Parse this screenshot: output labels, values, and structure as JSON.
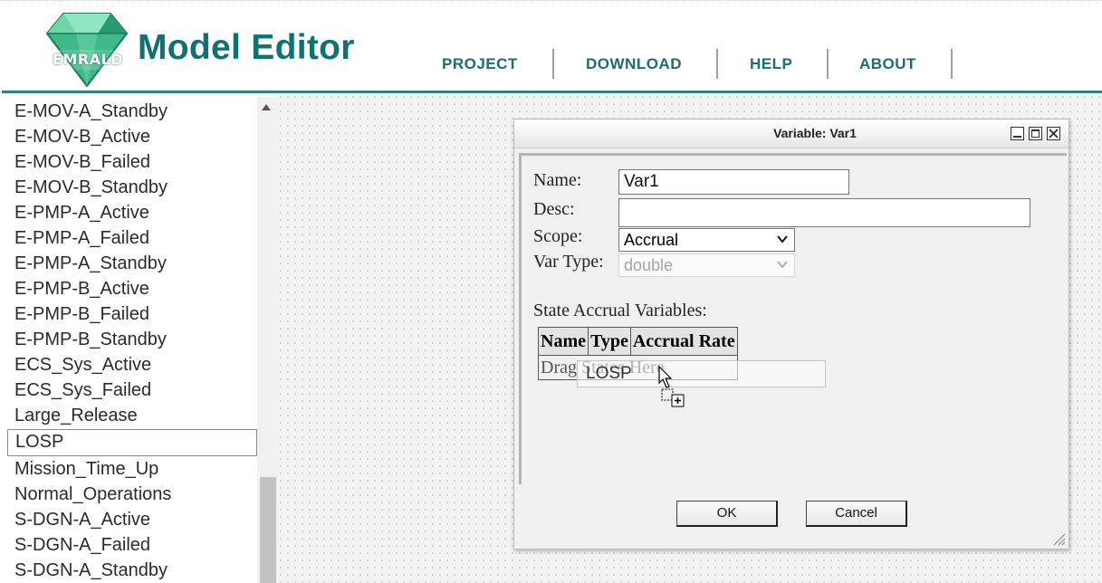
{
  "header": {
    "app_title": "Model Editor",
    "logo_text": "EMRALD",
    "nav": [
      {
        "label": "PROJECT"
      },
      {
        "label": "DOWNLOAD"
      },
      {
        "label": "HELP"
      },
      {
        "label": "ABOUT"
      }
    ]
  },
  "state_list": {
    "items": [
      "E-MOV-A_Standby",
      "E-MOV-B_Active",
      "E-MOV-B_Failed",
      "E-MOV-B_Standby",
      "E-PMP-A_Active",
      "E-PMP-A_Failed",
      "E-PMP-A_Standby",
      "E-PMP-B_Active",
      "E-PMP-B_Failed",
      "E-PMP-B_Standby",
      "ECS_Sys_Active",
      "ECS_Sys_Failed",
      "Large_Release",
      "LOSP",
      "Mission_Time_Up",
      "Normal_Operations",
      "S-DGN-A_Active",
      "S-DGN-A_Failed",
      "S-DGN-A_Standby"
    ],
    "selected": "LOSP"
  },
  "dialog": {
    "title": "Variable: Var1",
    "name_label": "Name:",
    "name_value": "Var1",
    "desc_label": "Desc:",
    "desc_value": "",
    "scope_label": "Scope:",
    "scope_value": "Accrual",
    "vartype_label": "Var Type:",
    "vartype_value": "double",
    "accrual_heading": "State Accrual Variables:",
    "table_headers": [
      "Name",
      "Type",
      "Accrual Rate"
    ],
    "drop_placeholder": "Drag States Here",
    "drag_item": "LOSP",
    "ok_label": "OK",
    "cancel_label": "Cancel"
  },
  "colors": {
    "brand_teal": "#0e7272",
    "header_line": "#2f8080"
  }
}
